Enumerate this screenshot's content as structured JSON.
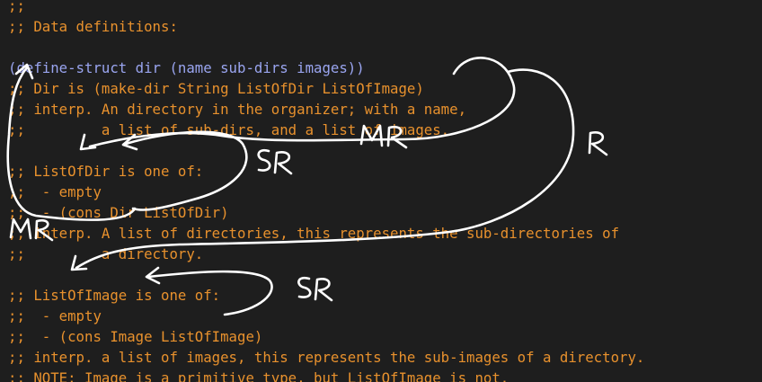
{
  "editor": {
    "lines": [
      {
        "text": ";;",
        "cls": "cmt"
      },
      {
        "text": ";; Data definitions:",
        "cls": "cmt"
      },
      {
        "text": "",
        "cls": "cmt"
      },
      {
        "text": "(define-struct dir (name sub-dirs images))",
        "cls": "kw"
      },
      {
        "text": ";; Dir is (make-dir String ListOfDir ListOfImage)",
        "cls": "cmt"
      },
      {
        "text": ";; interp. An directory in the organizer; with a name,",
        "cls": "cmt"
      },
      {
        "text": ";;         a list of sub-dirs, and a list of images.",
        "cls": "cmt"
      },
      {
        "text": "",
        "cls": "cmt"
      },
      {
        "text": ";; ListOfDir is one of:",
        "cls": "cmt"
      },
      {
        "text": ";;  - empty",
        "cls": "cmt"
      },
      {
        "text": ";;  - (cons Dir ListOfDir)",
        "cls": "cmt"
      },
      {
        "text": ";; interp. A list of directories, this represents the sub-directories of",
        "cls": "cmt"
      },
      {
        "text": ";;         a directory.",
        "cls": "cmt"
      },
      {
        "text": "",
        "cls": "cmt"
      },
      {
        "text": ";; ListOfImage is one of:",
        "cls": "cmt"
      },
      {
        "text": ";;  - empty",
        "cls": "cmt"
      },
      {
        "text": ";;  - (cons Image ListOfImage)",
        "cls": "cmt"
      },
      {
        "text": ";; interp. a list of images, this represents the sub-images of a directory.",
        "cls": "cmt"
      },
      {
        "text": ";; NOTE: Image is a primitive type, but ListOfImage is not.",
        "cls": "cmt"
      }
    ]
  },
  "annotations": {
    "mr_top": "MR",
    "mr_left": "MR",
    "sr_dir": "SR",
    "sr_image": "SR",
    "r_right": "R"
  },
  "colors": {
    "background": "#1e1e1e",
    "comment": "#e8912d",
    "keyword": "#9aa5f0",
    "ink": "#ffffff"
  }
}
